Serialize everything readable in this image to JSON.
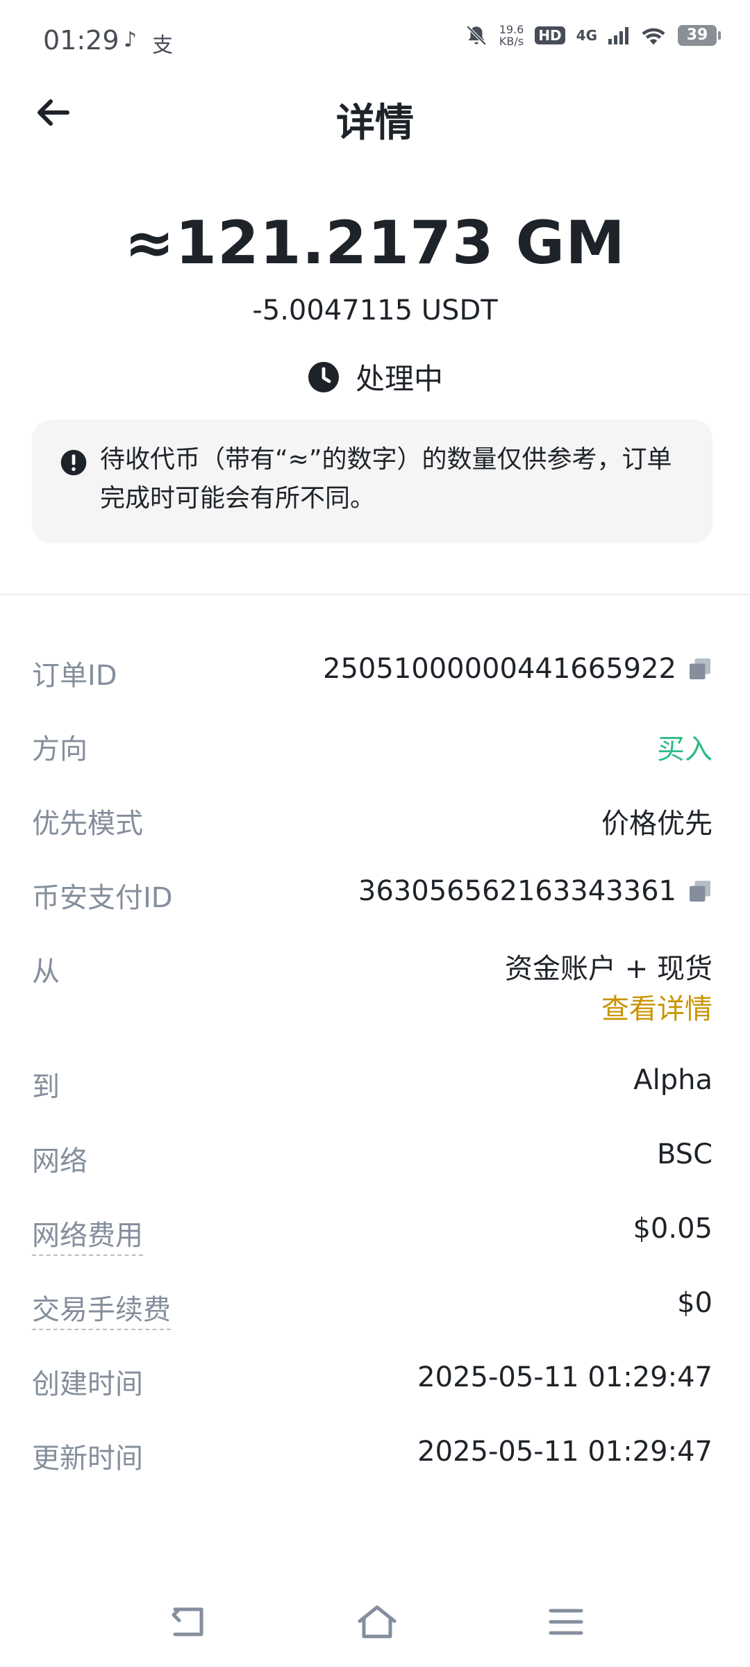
{
  "status_bar": {
    "time": "01:29",
    "left_icons": [
      "tiktok-icon",
      "alipay-icon"
    ],
    "speed_value": "19.6",
    "speed_unit": "KB/s",
    "hd": "HD",
    "network": "4G",
    "battery": "39"
  },
  "header": {
    "title": "详情"
  },
  "summary": {
    "amount": "≈121.2173 GM",
    "paid": "-5.0047115 USDT",
    "status": "处理中"
  },
  "notice": {
    "text": "待收代币（带有“≈”的数字）的数量仅供参考，订单完成时可能会有所不同。"
  },
  "details": {
    "order_id_label": "订单ID",
    "order_id_value": "250510000004416659​22",
    "direction_label": "方向",
    "direction_value": "买入",
    "priority_label": "优先模式",
    "priority_value": "价格优先",
    "binance_pay_label": "币安支付ID",
    "binance_pay_value": "363056562163343361",
    "from_label": "从",
    "from_value": "资金账户 + 现货",
    "from_link": "查看详情",
    "to_label": "到",
    "to_value": "Alpha",
    "network_label": "网络",
    "network_value": "BSC",
    "network_fee_label": "网络费用",
    "network_fee_value": "$0.05",
    "trade_fee_label": "交易手续费",
    "trade_fee_value": "$0",
    "created_label": "创建时间",
    "created_value": "2025-05-11 01:29:47",
    "updated_label": "更新时间",
    "updated_value": "2025-05-11 01:29:47"
  },
  "colors": {
    "green": "#2ebd85",
    "gold": "#c99400",
    "label_gray": "#848e9c",
    "text_dark": "#1e2329"
  }
}
